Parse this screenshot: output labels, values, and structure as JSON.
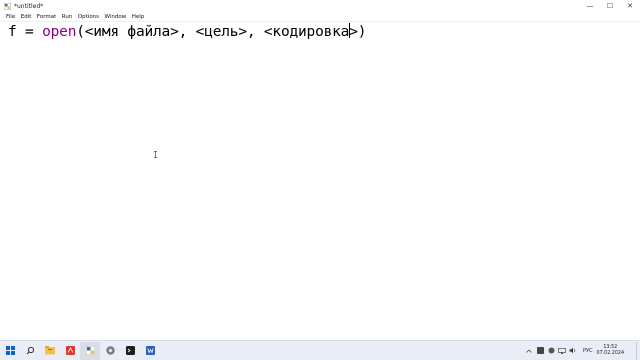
{
  "window": {
    "title": "*untitled*",
    "controls": {
      "minimize": "—",
      "maximize": "☐",
      "close": "✕"
    }
  },
  "menu": [
    "File",
    "Edit",
    "Format",
    "Run",
    "Options",
    "Window",
    "Help"
  ],
  "editor": {
    "code": {
      "before_keyword": "f = ",
      "keyword": "open",
      "after_keyword": "(<имя файла>, <цель>, <кодировка",
      "after_caret": ">)"
    }
  },
  "taskbar": {
    "icons": [
      "windows-start-icon",
      "search-icon",
      "explorer-icon",
      "pdf-app-icon",
      "idle-python-icon",
      "browser-icon",
      "terminal-icon",
      "word-icon"
    ],
    "language": "РУС",
    "time": "13:52",
    "date": "07.02.2024"
  },
  "colors": {
    "keyword": "#900090",
    "taskbar_bg": "#e9eef6"
  }
}
